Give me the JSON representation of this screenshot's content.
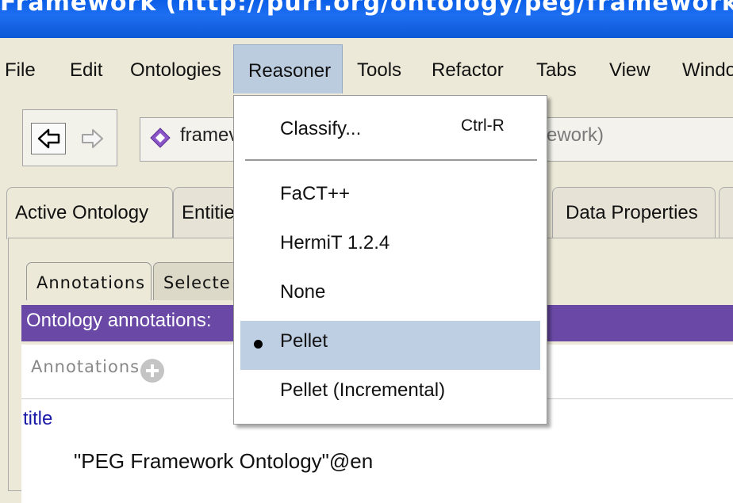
{
  "window": {
    "title": "Framework (http://purl.org/ontology/peg/framework) - [C:\\TC-W"
  },
  "menubar": {
    "items": [
      {
        "label": "File"
      },
      {
        "label": "Edit"
      },
      {
        "label": "Ontologies"
      },
      {
        "label": "Reasoner"
      },
      {
        "label": "Tools"
      },
      {
        "label": "Refactor"
      },
      {
        "label": "Tabs"
      },
      {
        "label": "View"
      },
      {
        "label": "Windo"
      }
    ],
    "active": "Reasoner"
  },
  "toolbar": {
    "back_icon": "arrow-left-icon",
    "forward_icon": "arrow-right-icon",
    "ontology_icon": "ontology-diamond-icon",
    "ontology_name": "framev",
    "ontology_suffix": "ework)"
  },
  "tabs": [
    {
      "label": "Active Ontology"
    },
    {
      "label": "Entitie"
    },
    {
      "label": "Data Properties"
    }
  ],
  "subtabs": [
    {
      "label": "Annotations"
    },
    {
      "label": "Selecte"
    }
  ],
  "panel": {
    "header": "Ontology annotations:",
    "annotations_label": "Annotations",
    "add_icon": "add-circle-icon",
    "annotation": {
      "property": "title",
      "value": "\"PEG Framework Ontology\"@en"
    }
  },
  "reasoner_menu": {
    "classify": {
      "label": "Classify...",
      "shortcut": "Ctrl-R"
    },
    "reasoners": [
      {
        "label": "FaCT++"
      },
      {
        "label": "HermiT 1.2.4"
      },
      {
        "label": "None"
      },
      {
        "label": "Pellet"
      },
      {
        "label": "Pellet (Incremental)"
      }
    ],
    "selected": "Pellet"
  },
  "colors": {
    "titlebar": "#0a5fe8",
    "header_purple": "#6a49a6",
    "menu_highlight": "#bfcfe3",
    "link_blue": "#1a1aa8"
  }
}
